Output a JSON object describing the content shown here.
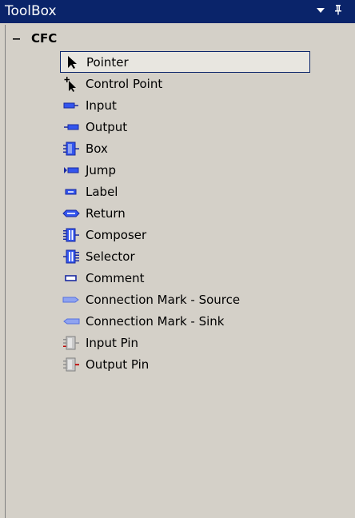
{
  "window": {
    "title": "ToolBox",
    "dropdown_glyph": "▾",
    "pin_glyph": "≡"
  },
  "group": {
    "collapse_glyph": "−",
    "label": "CFC"
  },
  "items": [
    {
      "label": "Pointer",
      "icon": "pointer-icon"
    },
    {
      "label": "Control Point",
      "icon": "control-point-icon"
    },
    {
      "label": "Input",
      "icon": "input-icon"
    },
    {
      "label": "Output",
      "icon": "output-icon"
    },
    {
      "label": "Box",
      "icon": "box-icon"
    },
    {
      "label": "Jump",
      "icon": "jump-icon"
    },
    {
      "label": "Label",
      "icon": "label-icon"
    },
    {
      "label": "Return",
      "icon": "return-icon"
    },
    {
      "label": "Composer",
      "icon": "composer-icon"
    },
    {
      "label": "Selector",
      "icon": "selector-icon"
    },
    {
      "label": "Comment",
      "icon": "comment-icon"
    },
    {
      "label": "Connection Mark - Source",
      "icon": "connection-mark-source-icon"
    },
    {
      "label": "Connection Mark - Sink",
      "icon": "connection-mark-sink-icon"
    },
    {
      "label": "Input Pin",
      "icon": "input-pin-icon"
    },
    {
      "label": "Output Pin",
      "icon": "output-pin-icon"
    }
  ],
  "colors": {
    "title_bar": "#0a246a",
    "background": "#d4d0c8",
    "icon_blue": "#3355ee",
    "icon_light_blue": "#8fa3f0",
    "pin_red": "#c00000"
  }
}
